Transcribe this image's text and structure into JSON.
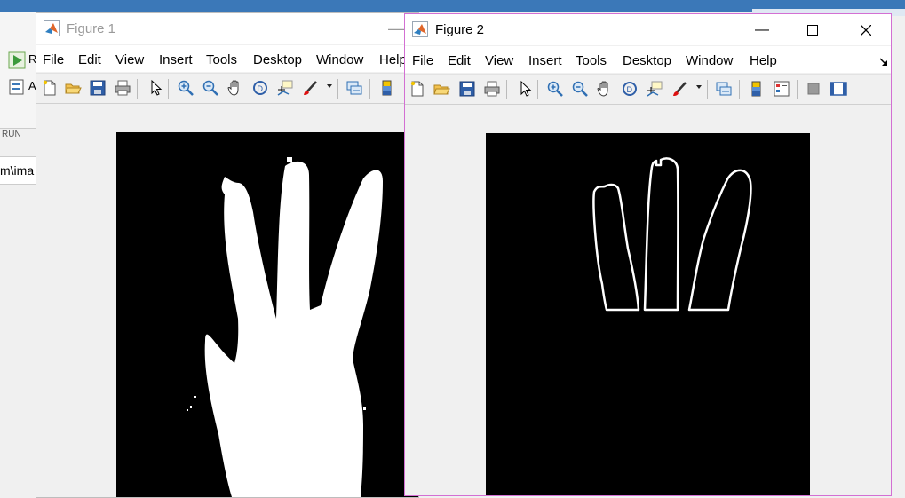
{
  "desktop": {
    "run_label": "RUN",
    "run_button_letter": "R",
    "second_button_letter": "A",
    "address_text": "m\\ima"
  },
  "figure1": {
    "title": "Figure 1",
    "window_state": "inactive",
    "menu": [
      "File",
      "Edit",
      "View",
      "Insert",
      "Tools",
      "Desktop",
      "Window",
      "Help"
    ],
    "image": "binary hand mask (white hand with three extended fingers on black)"
  },
  "figure2": {
    "title": "Figure 2",
    "window_state": "active",
    "menu": [
      "File",
      "Edit",
      "View",
      "Insert",
      "Tools",
      "Desktop",
      "Window",
      "Help"
    ],
    "image": "white outlines of three fingers on black"
  },
  "toolbar_icons": [
    "new-figure-icon",
    "open-file-icon",
    "save-icon",
    "print-icon",
    "pointer-icon",
    "zoom-in-icon",
    "zoom-out-icon",
    "pan-icon",
    "rotate-3d-icon",
    "data-cursor-icon",
    "brush-icon",
    "link-plot-icon",
    "colorbar-icon",
    "legend-icon",
    "hide-plot-tools-icon",
    "show-plot-tools-icon"
  ],
  "colors": {
    "accent": "#3b78b8",
    "active_border": "#d36fd3",
    "image_background": "#000000",
    "image_foreground": "#ffffff"
  }
}
